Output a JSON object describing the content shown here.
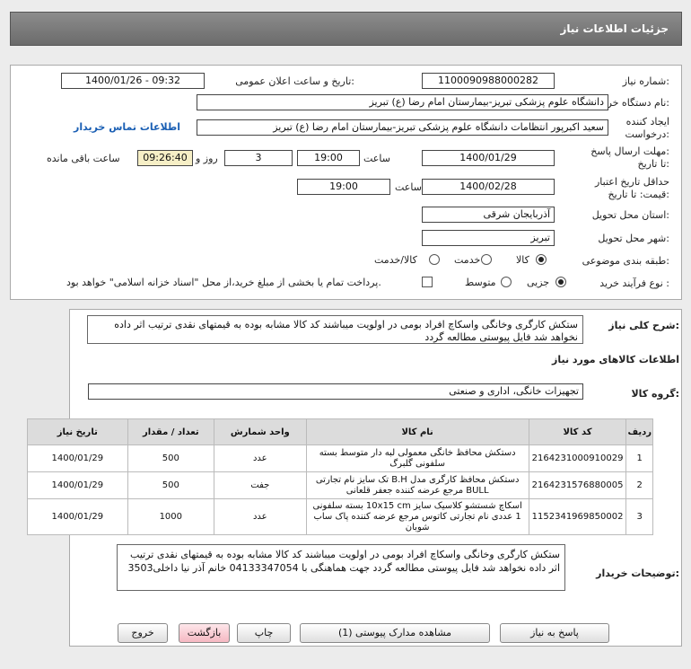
{
  "header": {
    "title": "جزئیات اطلاعات نیاز"
  },
  "form": {
    "need_number_label": "شماره نیاز:",
    "need_number": "1100090988000282",
    "announce_label": "تاریخ و ساعت اعلان عمومی:",
    "announce_value": "1400/01/26 - 09:32",
    "buyer_org_label": "نام دستگاه خریدار:",
    "buyer_org": "دانشگاه علوم پزشکی تبریز-بیمارستان امام رضا (ع) تبریز",
    "creator_label_1": "ایجاد کننده",
    "creator_label_2": "درخواست:",
    "creator": "سعید اکبرپور انتظامات دانشگاه علوم پزشکی تبریز-بیمارستان امام رضا (ع) تبریز",
    "contact_link": "اطلاعات تماس خریدار",
    "deadline_label_1": "مهلت ارسال پاسخ:",
    "deadline_label_2": "تا تاریخ:",
    "deadline_date": "1400/01/29",
    "time_label": "ساعت",
    "deadline_time": "19:00",
    "days_value": "3",
    "days_label": "روز و",
    "remaining_time": "09:26:40",
    "remaining_label": "ساعت باقی مانده",
    "validity_label_1": "حداقل تاریخ اعتبار",
    "validity_label_2": "قیمت: تا تاریخ:",
    "validity_date": "1400/02/28",
    "validity_time": "19:00",
    "province_label": "استان محل تحویل:",
    "province": "آذربایجان شرقی",
    "city_label": "شهر محل تحویل:",
    "city": "تبریز",
    "category_label": "طبقه بندی موضوعی:",
    "category_options": [
      "کالا",
      "خدمت",
      "کالا/خدمت"
    ],
    "category_selected": "کالا",
    "process_label": "نوع فرآیند خرید :",
    "process_options": [
      "جزیی",
      "متوسط"
    ],
    "process_selected": "جزیی",
    "treasury_note": "پرداخت تمام یا بخشی از مبلغ خرید،از محل \"اسناد خزانه اسلامی\" خواهد بود."
  },
  "summary": {
    "label": "شرح کلی نیاز:",
    "text": "ستکش کارگری وخانگی واسکاچ افراد بومی در اولویت میباشند کد کالا مشابه بوده به قیمتهای نقدی ترتیب اثر داده نخواهد شد فایل پیوستی مطالعه گردد"
  },
  "goods": {
    "section_title": "اطلاعات کالاهای مورد نیاز",
    "group_label": "گروه کالا:",
    "group_value": "تجهیزات خانگی، اداری و صنعتی",
    "columns": [
      "ردیف",
      "کد کالا",
      "نام کالا",
      "واحد شمارش",
      "تعداد / مقدار",
      "تاریخ نیاز"
    ],
    "rows": [
      {
        "idx": "1",
        "code": "2164231000910029",
        "name": "دستکش محافظ خانگی معمولی لبه دار متوسط بسته سلفونی گلبرگ",
        "unit": "عدد",
        "qty": "500",
        "date": "1400/01/29"
      },
      {
        "idx": "2",
        "code": "2164231576880005",
        "name": "دستکش محافظ کارگری مدل B.H تک سایز نام تجارتی BULL مرجع عرضه کننده جعفر قلعانی",
        "unit": "جفت",
        "qty": "500",
        "date": "1400/01/29"
      },
      {
        "idx": "3",
        "code": "1152341969850002",
        "name": "اسکاچ شستشو کلاسیک سایز 10x15 cm بسته سلفونی 1 عددی نام تجارتی کاتوس مرجع عرضه کننده پاک ساب شوبان",
        "unit": "عدد",
        "qty": "1000",
        "date": "1400/01/29"
      }
    ]
  },
  "buyer_notes": {
    "label": "توضیحات خریدار:",
    "text": "ستکش کارگری وخانگی واسکاچ افراد بومی در اولویت میباشند کد کالا مشابه بوده به قیمتهای نقدی ترتیب اثر داده نخواهد شد فایل پیوستی مطالعه گردد جهت هماهنگی با 04133347054 خانم آذر نیا داخلی3503"
  },
  "buttons": {
    "reply": "پاسخ به نیاز",
    "attachments": "مشاهده مدارک پیوستی (1)",
    "print": "چاپ",
    "back": "بازگشت",
    "exit": "خروج"
  }
}
